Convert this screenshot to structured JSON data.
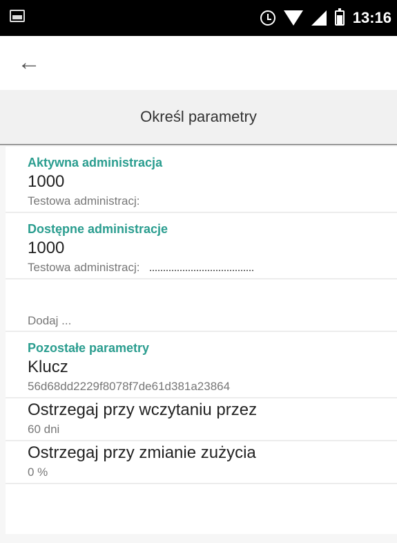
{
  "status_bar": {
    "time": "13:16",
    "left_icon": "image-icon",
    "icons": [
      "alarm-icon",
      "wifi-icon",
      "signal-icon",
      "battery-icon"
    ]
  },
  "toolbar": {
    "back_icon": "arrow-left-icon"
  },
  "header": {
    "title": "Określ parametry"
  },
  "sections": {
    "active": {
      "label": "Aktywna administracja",
      "item": {
        "title": "1000",
        "subtitle": "Testowa administracj:"
      }
    },
    "available": {
      "label": "Dostępne administracje",
      "item": {
        "title": "1000",
        "subtitle": "Testowa administracj:"
      },
      "add_label": "Dodaj ..."
    },
    "other": {
      "label": "Pozostałe parametry",
      "items": [
        {
          "title": "Klucz",
          "subtitle": "56d68dd2229f8078f7de61d381a23864"
        },
        {
          "title": "Ostrzegaj przy wczytaniu przez",
          "subtitle": "60 dni"
        },
        {
          "title": "Ostrzegaj przy zmianie zużycia",
          "subtitle": "0 %"
        }
      ]
    }
  },
  "colors": {
    "accent": "#2a9d8f",
    "statusbar_bg": "#000000",
    "header_bg": "#f1f1f1",
    "page_bg": "#f6f6f6"
  }
}
